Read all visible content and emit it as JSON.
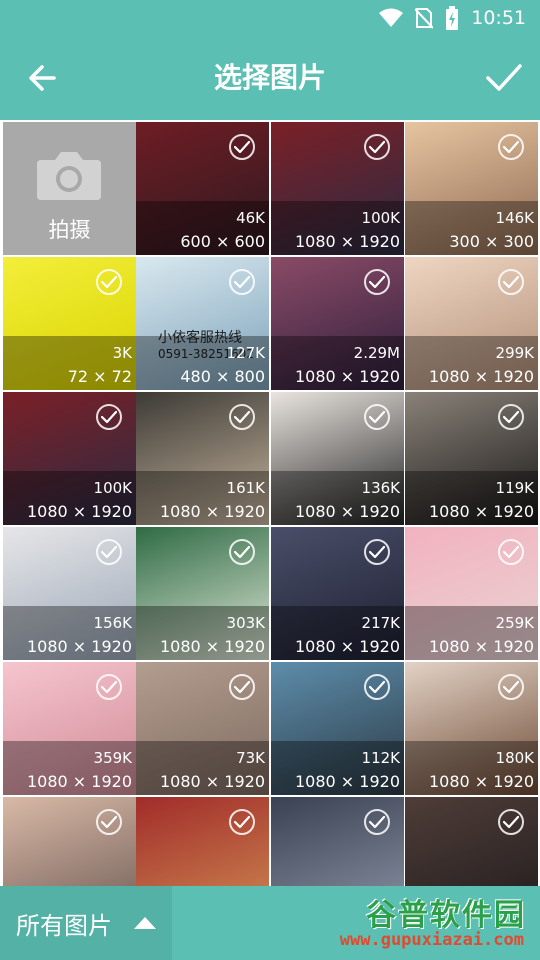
{
  "status_bar": {
    "time": "10:51"
  },
  "app_bar": {
    "title": "选择图片"
  },
  "camera_tile": {
    "label": "拍摄"
  },
  "photos": [
    {
      "size": "46K",
      "dimensions": "600 × 600",
      "colors": [
        "#6f1d24",
        "#2c1a20"
      ]
    },
    {
      "size": "100K",
      "dimensions": "1080 × 1920",
      "colors": [
        "#7b2027",
        "#2a2b42"
      ]
    },
    {
      "size": "146K",
      "dimensions": "300 × 300",
      "colors": [
        "#e7c4a0",
        "#8d6a52"
      ]
    },
    {
      "size": "3K",
      "dimensions": "72 × 72",
      "colors": [
        "#f3ee3a",
        "#d9d400"
      ]
    },
    {
      "size": "127K",
      "dimensions": "480 × 800",
      "colors": [
        "#d8e8ef",
        "#7ca1b9"
      ],
      "overlay_text": "小依客服热线",
      "overlay_phone": "0591-38251602"
    },
    {
      "size": "2.29M",
      "dimensions": "1080 × 1920",
      "colors": [
        "#8a4b66",
        "#2f1f3d"
      ]
    },
    {
      "size": "299K",
      "dimensions": "1080 × 1920",
      "colors": [
        "#efd6c2",
        "#b08e78"
      ]
    },
    {
      "size": "100K",
      "dimensions": "1080 × 1920",
      "colors": [
        "#7b2027",
        "#2a2b42"
      ]
    },
    {
      "size": "161K",
      "dimensions": "1080 × 1920",
      "colors": [
        "#3d3b36",
        "#c7b59e"
      ]
    },
    {
      "size": "136K",
      "dimensions": "1080 × 1920",
      "colors": [
        "#e9e4df",
        "#222222"
      ]
    },
    {
      "size": "119K",
      "dimensions": "1080 × 1920",
      "colors": [
        "#8a8279",
        "#191717"
      ]
    },
    {
      "size": "156K",
      "dimensions": "1080 × 1920",
      "colors": [
        "#e6e6e8",
        "#9aa6b6"
      ]
    },
    {
      "size": "303K",
      "dimensions": "1080 × 1920",
      "colors": [
        "#2f6b45",
        "#dfe7d6"
      ]
    },
    {
      "size": "217K",
      "dimensions": "1080 × 1920",
      "colors": [
        "#4a4e68",
        "#1d2032"
      ]
    },
    {
      "size": "259K",
      "dimensions": "1080 × 1920",
      "colors": [
        "#f2b2bf",
        "#e9d3d4"
      ]
    },
    {
      "size": "359K",
      "dimensions": "1080 × 1920",
      "colors": [
        "#f6c5ce",
        "#cf8a96"
      ]
    },
    {
      "size": "73K",
      "dimensions": "1080 × 1920",
      "colors": [
        "#b39d8f",
        "#7e6a60"
      ]
    },
    {
      "size": "112K",
      "dimensions": "1080 × 1920",
      "colors": [
        "#5d8dab",
        "#2c3a45"
      ]
    },
    {
      "size": "180K",
      "dimensions": "1080 × 1920",
      "colors": [
        "#e2d2c5",
        "#6e4a35"
      ]
    },
    {
      "size": "",
      "dimensions": "",
      "colors": [
        "#d9b9a6",
        "#6c5a55"
      ]
    },
    {
      "size": "",
      "dimensions": "",
      "colors": [
        "#a12c2a",
        "#cf8c53"
      ]
    },
    {
      "size": "",
      "dimensions": "",
      "colors": [
        "#3a4152",
        "#8e96a7"
      ]
    },
    {
      "size": "",
      "dimensions": "",
      "colors": [
        "#4f3d38",
        "#1f1b1d"
      ]
    }
  ],
  "bottom_bar": {
    "album_label": "所有图片"
  },
  "watermark": {
    "main": "谷普软件园",
    "sub": "www.gupuxiazai.com"
  },
  "theme": {
    "accent": "#5bbfb3"
  }
}
